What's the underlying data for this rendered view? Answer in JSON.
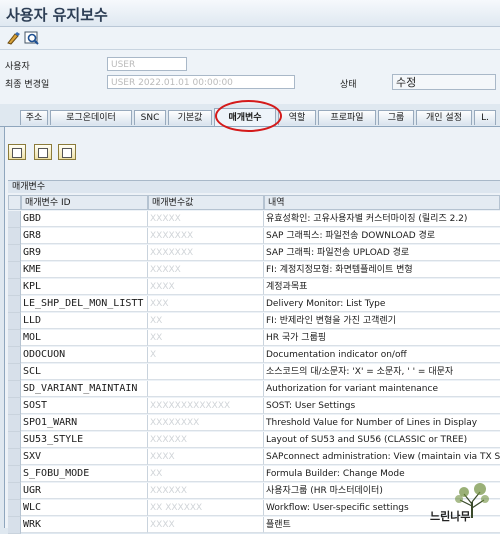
{
  "window": {
    "title": "사용자 유지보수"
  },
  "header": {
    "user_label": "사용자",
    "user_value": "USER",
    "last_changed_label": "최종 변경일",
    "last_changed_value": "USER 2022.01.01 00:00:00",
    "status_label": "상태",
    "status_value": "수정"
  },
  "tabs": [
    "주소",
    "로그온데이터",
    "SNC",
    "기본값",
    "매개변수",
    "역할",
    "프로파일",
    "그룹",
    "개인 설정",
    "L."
  ],
  "active_tab": "매개변수",
  "table": {
    "title": "매개변수",
    "columns": [
      "매개변수 ID",
      "매개변수값",
      "내역"
    ],
    "rows": [
      {
        "id": "GBD",
        "value": "XXXXX",
        "desc": "유효성확인: 고유사용자별 커스터마이징 (릴리즈 2.2)"
      },
      {
        "id": "GR8",
        "value": "XXXXXXX",
        "desc": "SAP 그래픽스: 파일전송 DOWNLOAD 경로"
      },
      {
        "id": "GR9",
        "value": "XXXXXXX",
        "desc": "SAP 그래픽: 파일전송 UPLOAD 경로"
      },
      {
        "id": "KME",
        "value": "XXXXX",
        "desc": "FI: 계정지정모형: 화면템플레이트 변형"
      },
      {
        "id": "KPL",
        "value": "XXXX",
        "desc": "계정과목표"
      },
      {
        "id": "LE_SHP_DEL_MON_LISTT",
        "value": "XXX",
        "desc": "Delivery Monitor: List Type"
      },
      {
        "id": "LLD",
        "value": "XX",
        "desc": "FI: 반제라인 변형을 가진 고객렌기"
      },
      {
        "id": "MOL",
        "value": "XX",
        "desc": "HR 국가 그룹핑"
      },
      {
        "id": "ODOCUON",
        "value": "X",
        "desc": "Documentation indicator on/off"
      },
      {
        "id": "SCL",
        "value": "",
        "desc": "소스코드의 대/소문자: 'X' = 소문자, ' ' = 대문자"
      },
      {
        "id": "SD_VARIANT_MAINTAIN",
        "value": "",
        "desc": "Authorization for variant maintenance"
      },
      {
        "id": "SOST",
        "value": "XXXXXXXXXXXXX",
        "desc": "SOST: User Settings"
      },
      {
        "id": "SPO1_WARN",
        "value": "XXXXXXXX",
        "desc": "Threshold Value for Number of Lines in Display"
      },
      {
        "id": "SU53_STYLE",
        "value": "XXXXXX",
        "desc": "Layout of SU53 and SU56 (CLASSIC or TREE)"
      },
      {
        "id": "SXV",
        "value": "XXXX",
        "desc": "SAPconnect administration: View (maintain via TX SCOT)"
      },
      {
        "id": "S_FOBU_MODE",
        "value": "XX",
        "desc": "Formula Builder: Change Mode"
      },
      {
        "id": "UGR",
        "value": "XXXXXX",
        "desc": "사용자그룹 (HR 마스터데이터)"
      },
      {
        "id": "WLC",
        "value": "XX XXXXXX",
        "desc": "Workflow: User-specific settings"
      },
      {
        "id": "WRK",
        "value": "XXXX",
        "desc": "플랜트"
      }
    ]
  },
  "watermark": {
    "text": "느린나무"
  },
  "colors": {
    "highlight_circle": "#d41a1a",
    "panel_bg": "#edf2f7",
    "title_text": "#2d3e55"
  },
  "icons": [
    "change-display-icon",
    "other-user-icon",
    "select-all-icon",
    "deselect-all-icon",
    "details-icon"
  ]
}
